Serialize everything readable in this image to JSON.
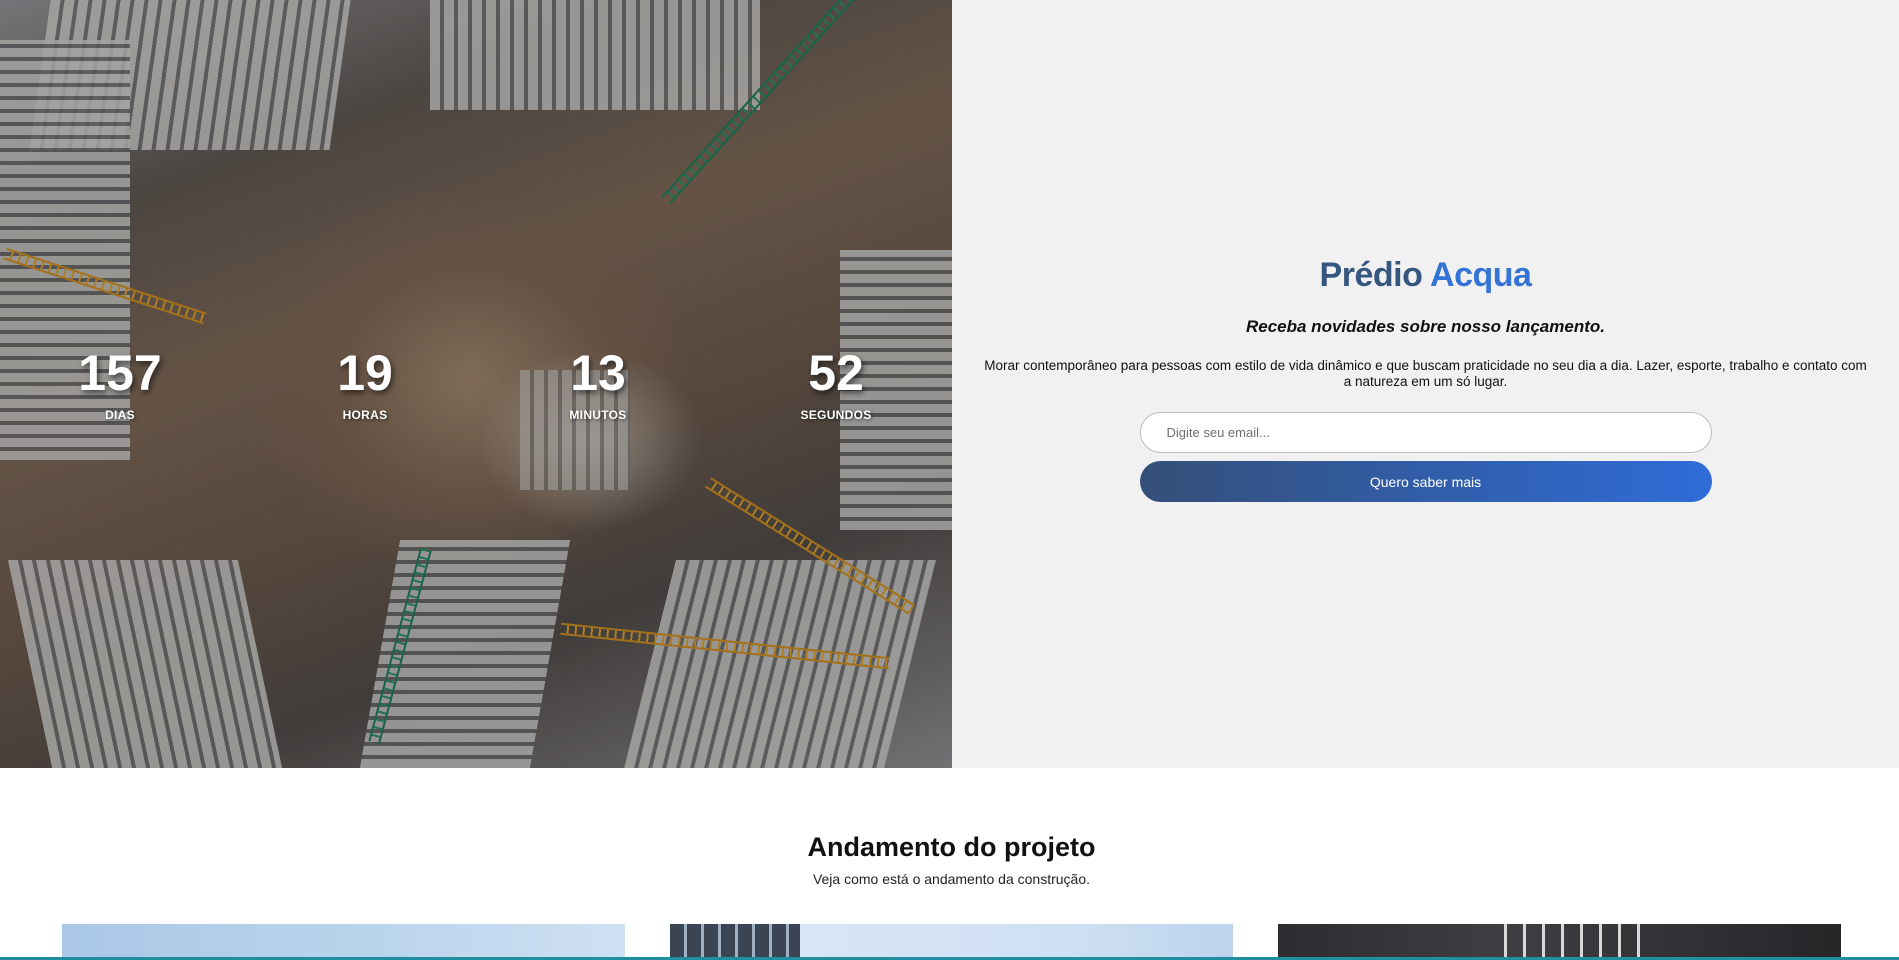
{
  "countdown": [
    {
      "value": "157",
      "label": "DIAS"
    },
    {
      "value": "19",
      "label": "HORAS"
    },
    {
      "value": "13",
      "label": "MINUTOS"
    },
    {
      "value": "52",
      "label": "SEGUNDOS"
    }
  ],
  "panel": {
    "brand_part1": "Prédio",
    "brand_part2": "Acqua",
    "tagline": "Receba novidades sobre nosso lançamento.",
    "description": "Morar contemporâneo para pessoas com estilo de vida dinâmico e que buscam praticidade no seu dia a dia. Lazer, esporte, trabalho e contato com a natureza em um só lugar.",
    "email_placeholder": "Digite seu email...",
    "button_label": "Quero saber mais"
  },
  "progress": {
    "title": "Andamento do projeto",
    "subtitle": "Veja como está o andamento da construção."
  },
  "colors": {
    "brand_dark": "#35567f",
    "brand_accent": "#3474d6",
    "panel_bg": "#f1f1f1",
    "button_gradient_start": "#344f78",
    "button_gradient_end": "#2f6cd8"
  }
}
